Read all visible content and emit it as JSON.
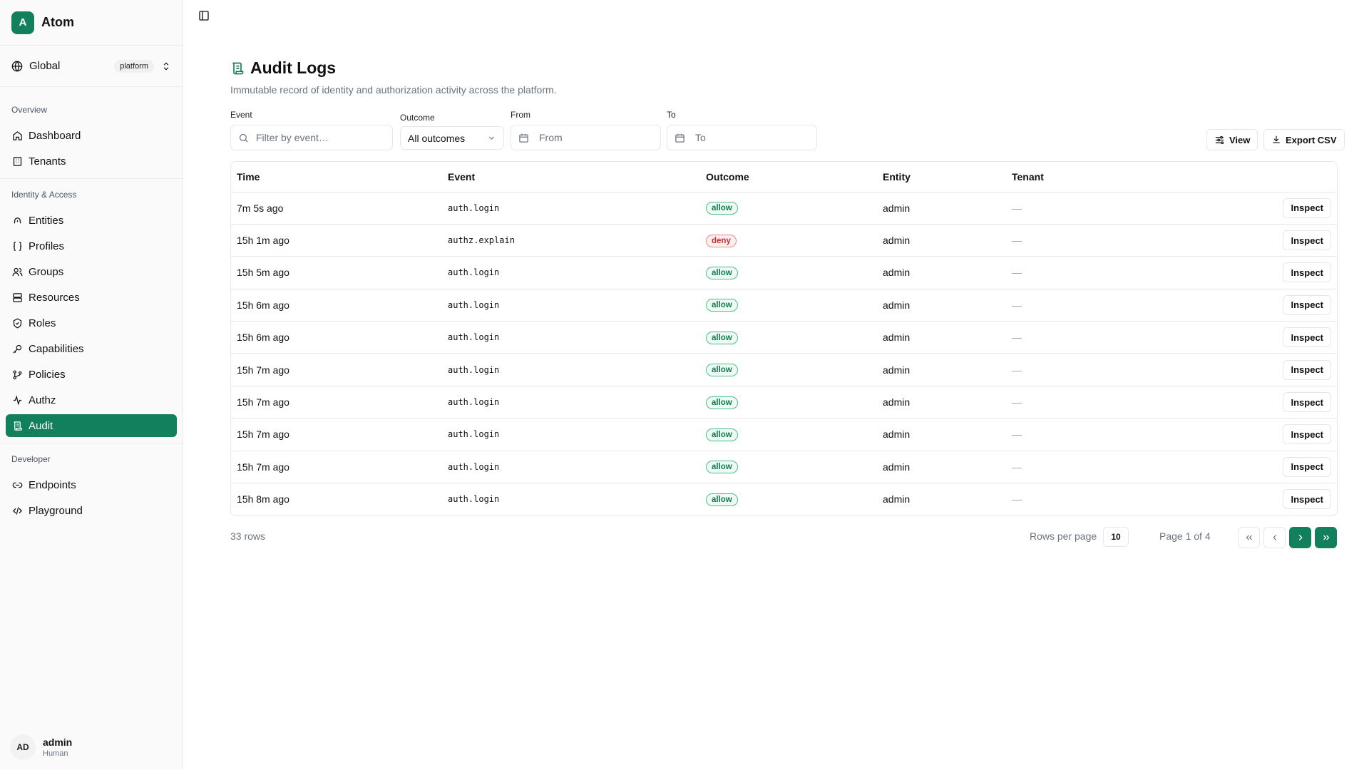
{
  "app": {
    "logo_letter": "A",
    "name": "Atom"
  },
  "scope": {
    "label": "Global",
    "badge": "platform"
  },
  "sidebar": {
    "sections": [
      {
        "title": "Overview",
        "items": [
          {
            "label": "Dashboard",
            "icon": "home-icon"
          },
          {
            "label": "Tenants",
            "icon": "building-icon"
          }
        ]
      },
      {
        "title": "Identity & Access",
        "items": [
          {
            "label": "Entities",
            "icon": "fingerprint-icon"
          },
          {
            "label": "Profiles",
            "icon": "braces-icon"
          },
          {
            "label": "Groups",
            "icon": "users-icon"
          },
          {
            "label": "Resources",
            "icon": "server-icon"
          },
          {
            "label": "Roles",
            "icon": "shield-icon"
          },
          {
            "label": "Capabilities",
            "icon": "key-icon"
          },
          {
            "label": "Policies",
            "icon": "git-branch-icon"
          },
          {
            "label": "Authz",
            "icon": "activity-icon"
          },
          {
            "label": "Audit",
            "icon": "scroll-icon",
            "active": true
          }
        ]
      },
      {
        "title": "Developer",
        "items": [
          {
            "label": "Endpoints",
            "icon": "link-icon"
          },
          {
            "label": "Playground",
            "icon": "code-icon"
          }
        ]
      }
    ]
  },
  "user": {
    "initials": "AD",
    "name": "admin",
    "role": "Human"
  },
  "page": {
    "title": "Audit Logs",
    "subtitle": "Immutable record of identity and authorization activity across the platform."
  },
  "filters": {
    "event": {
      "label": "Event",
      "placeholder": "Filter by event…"
    },
    "outcome": {
      "label": "Outcome",
      "value": "All outcomes"
    },
    "from": {
      "label": "From",
      "placeholder": "From"
    },
    "to": {
      "label": "To",
      "placeholder": "To"
    }
  },
  "toolbar": {
    "view_label": "View",
    "export_label": "Export CSV"
  },
  "table": {
    "columns": [
      "Time",
      "Event",
      "Outcome",
      "Entity",
      "Tenant"
    ],
    "action_label": "Inspect",
    "rows": [
      {
        "time": "7m 5s ago",
        "event": "auth.login",
        "outcome": "allow",
        "entity": "admin",
        "tenant": "—"
      },
      {
        "time": "15h 1m ago",
        "event": "authz.explain",
        "outcome": "deny",
        "entity": "admin",
        "tenant": "—"
      },
      {
        "time": "15h 5m ago",
        "event": "auth.login",
        "outcome": "allow",
        "entity": "admin",
        "tenant": "—"
      },
      {
        "time": "15h 6m ago",
        "event": "auth.login",
        "outcome": "allow",
        "entity": "admin",
        "tenant": "—"
      },
      {
        "time": "15h 6m ago",
        "event": "auth.login",
        "outcome": "allow",
        "entity": "admin",
        "tenant": "—"
      },
      {
        "time": "15h 7m ago",
        "event": "auth.login",
        "outcome": "allow",
        "entity": "admin",
        "tenant": "—"
      },
      {
        "time": "15h 7m ago",
        "event": "auth.login",
        "outcome": "allow",
        "entity": "admin",
        "tenant": "—"
      },
      {
        "time": "15h 7m ago",
        "event": "auth.login",
        "outcome": "allow",
        "entity": "admin",
        "tenant": "—"
      },
      {
        "time": "15h 7m ago",
        "event": "auth.login",
        "outcome": "allow",
        "entity": "admin",
        "tenant": "—"
      },
      {
        "time": "15h 8m ago",
        "event": "auth.login",
        "outcome": "allow",
        "entity": "admin",
        "tenant": "—"
      }
    ]
  },
  "pagination": {
    "rows_total": "33 rows",
    "rows_per_page_label": "Rows per page",
    "rows_per_page": "10",
    "page_label": "Page 1 of 4"
  },
  "colors": {
    "accent": "#12805c",
    "allow": "#0f7a50",
    "deny": "#c53030"
  }
}
